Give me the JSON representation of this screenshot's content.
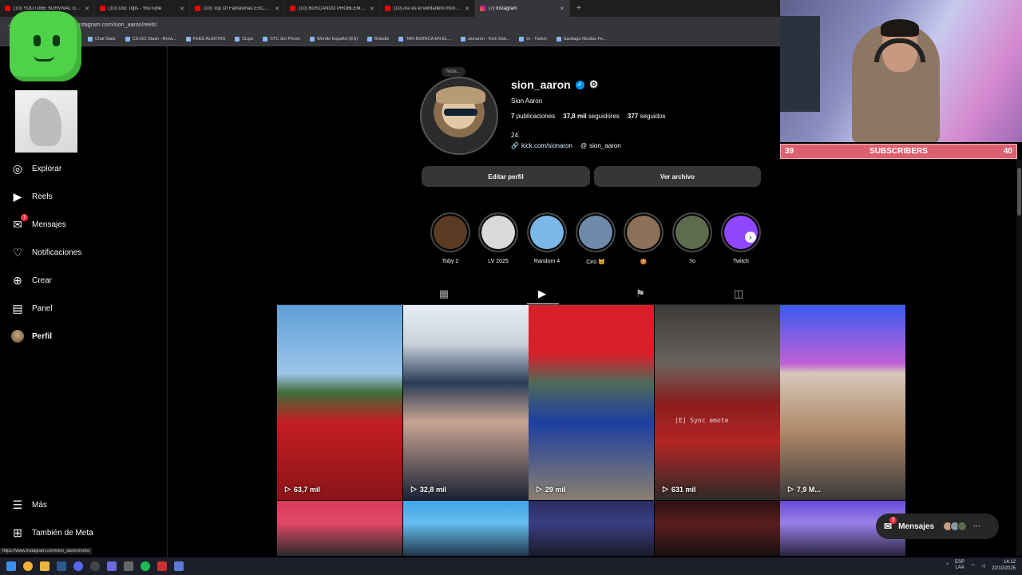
{
  "browser": {
    "tabs": [
      {
        "title": "(10) YOUTUBE SURVIVAL GAM...",
        "active": false
      },
      {
        "title": "(10) Doc Tops - YouTube",
        "active": false
      },
      {
        "title": "(10) Top 10 Fantasmas ESCALOC...",
        "active": false
      },
      {
        "title": "(10) BUSCANDO PROBLEMAS E...",
        "active": false
      },
      {
        "title": "(10) Así es el verdadero mundo...",
        "active": false
      },
      {
        "title": "(7) Instagram",
        "active": true
      }
    ],
    "new_tab": "+",
    "url": "instagram.com/sion_aaron/reels/",
    "bookmarks": [
      "Chat Stats",
      "CS:GO Stash - Brow...",
      "FEED ALERTAS",
      "CLips",
      "STC Set Prices",
      "Wordle Español (ES)",
      "Boludle",
      "TAN BIONICA EN EL...",
      "sionaron - Kick Stat...",
      "trr - Twitch",
      "Santiago Nicolas Fe..."
    ],
    "status_url": "https://www.instagram.com/sion_aaron/reels/"
  },
  "sidebar": {
    "items": [
      {
        "label": "Explorar",
        "icon": "compass-icon"
      },
      {
        "label": "Reels",
        "icon": "reels-icon"
      },
      {
        "label": "Mensajes",
        "icon": "messenger-icon",
        "badge": "7"
      },
      {
        "label": "Notificaciones",
        "icon": "heart-icon"
      },
      {
        "label": "Crear",
        "icon": "plus-square-icon"
      },
      {
        "label": "Panel",
        "icon": "chart-icon"
      },
      {
        "label": "Perfil",
        "icon": "avatar"
      }
    ],
    "more": "Más",
    "meta": "También de Meta"
  },
  "profile": {
    "note": "Nota...",
    "username": "sion_aaron",
    "full_name": "Sion Aaron",
    "posts_count": "7",
    "posts_label": "publicaciones",
    "followers_count": "37,8 mil",
    "followers_label": "seguidores",
    "following_count": "377",
    "following_label": "seguidos",
    "bio": "24.",
    "link": "kick.com/sionaron",
    "threads": "sion_aaron",
    "edit_button": "Editar perfil",
    "archive_button": "Ver archivo"
  },
  "highlights": [
    {
      "label": "Toby 2",
      "color": "#5a3a22"
    },
    {
      "label": "LV 2025",
      "color": "#d9d9d9"
    },
    {
      "label": "Random 4",
      "color": "#79b8e8"
    },
    {
      "label": "Ciro 🐱",
      "color": "#6e8aa8"
    },
    {
      "label": "🍪",
      "color": "#8c7058"
    },
    {
      "label": "Yo",
      "color": "#5d6b4e"
    },
    {
      "label": "Twitch",
      "color": "#9146ff"
    }
  ],
  "tabs": [
    "posts-tab",
    "reels-tab",
    "saved-tab",
    "tagged-tab"
  ],
  "reels": [
    {
      "views": "63,7 mil",
      "bg": "linear-gradient(180deg,#5fa0d8 0%,#9cc6ea 35%,#3f6b3a 45%,#c21d22 60%,#8a1418 100%)"
    },
    {
      "views": "32,8 mil",
      "bg": "linear-gradient(180deg,#e8eef5 0%,#c9d1da 20%,#2a3b58 40%,#c8a590 60%,#1a2236 100%)"
    },
    {
      "views": "29 mil",
      "bg": "linear-gradient(180deg,#d8202a 0%,#d8202a 25%,#4f6a5a 40%,#1d3fa0 60%,#8a8070 100%)"
    },
    {
      "views": "631 mil",
      "bg": "linear-gradient(180deg,#3c3a38 0%,#6a635e 30%,#8a1e1e 50%,#b32424 70%,#2c2a29 100%)",
      "overlay": "[E] Sync emote"
    },
    {
      "views": "7,9 M...",
      "bg": "linear-gradient(180deg,#3b5cf0 0%,#c05fd6 30%,#d6c8b8 35%,#b08868 65%,#3a3a3a 100%)"
    },
    {
      "views": "",
      "bg": "linear-gradient(180deg,#d93a5a 0%,#e04868 40%,#2a2a2a 100%)"
    },
    {
      "views": "",
      "bg": "linear-gradient(180deg,#3ea4e8 0%,#66bff0 40%,#22364a 100%)"
    },
    {
      "views": "",
      "bg": "linear-gradient(180deg,#2a2c62 0%,#3a3e82 40%,#1a1a2a 100%)"
    },
    {
      "views": "",
      "bg": "linear-gradient(180deg,#2b1010 0%,#5a1f1f 40%,#1a0f0f 100%)"
    },
    {
      "views": "",
      "bg": "linear-gradient(180deg,#6a4bd8 0%,#9880e8 40%,#2a2440 100%)"
    }
  ],
  "stream": {
    "sub_left": "39",
    "sub_label": "SUBSCRIBERS",
    "sub_right": "40"
  },
  "messages_pill": {
    "label": "Mensajes",
    "badge": "7"
  },
  "taskbar": {
    "lang_top": "ESP",
    "lang_bottom": "LAA",
    "time": "14:12",
    "date": "22/10/2025"
  }
}
